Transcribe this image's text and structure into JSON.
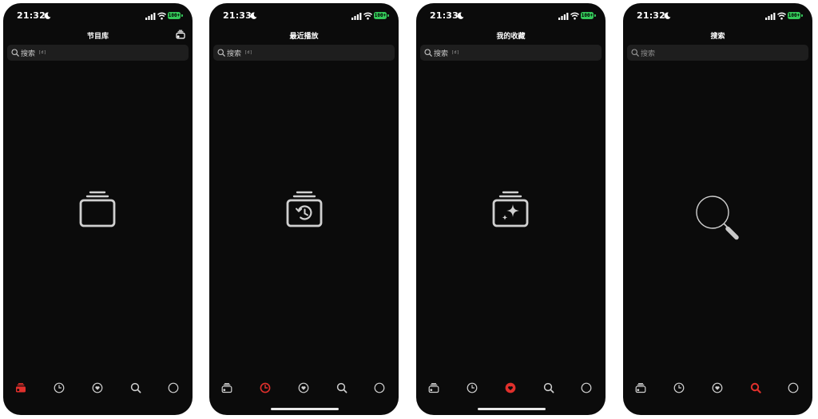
{
  "screens": [
    {
      "time": "21:32",
      "battery": "100+",
      "title": "节目库",
      "search_placeholder": "搜索",
      "search_shortcut": "[d]",
      "empty_icon": "library-stack-icon",
      "active_tab": "library",
      "has_home_indicator": false,
      "has_header_action": true
    },
    {
      "time": "21:33",
      "battery": "100+",
      "title": "最近播放",
      "search_placeholder": "搜索",
      "search_shortcut": "[d]",
      "empty_icon": "history-stack-icon",
      "active_tab": "recent",
      "has_home_indicator": true,
      "has_header_action": false
    },
    {
      "time": "21:33",
      "battery": "100+",
      "title": "我的收藏",
      "search_placeholder": "搜索",
      "search_shortcut": "[d]",
      "empty_icon": "favorites-sparkle-stack-icon",
      "active_tab": "favorites",
      "has_home_indicator": true,
      "has_header_action": false
    },
    {
      "time": "21:32",
      "battery": "100+",
      "title": "搜索",
      "search_placeholder": "搜索",
      "search_shortcut": "",
      "empty_icon": "large-magnifier-icon",
      "active_tab": "search",
      "has_home_indicator": false,
      "has_header_action": false
    }
  ],
  "tabs": [
    {
      "id": "library",
      "icon": "library-icon"
    },
    {
      "id": "recent",
      "icon": "clock-icon"
    },
    {
      "id": "favorites",
      "icon": "heart-icon"
    },
    {
      "id": "search",
      "icon": "search-icon"
    },
    {
      "id": "profile",
      "icon": "profile-icon"
    }
  ],
  "colors": {
    "background": "#0b0b0b",
    "accent": "#e0302c",
    "battery": "#34c759",
    "search_field": "#1e1e1e",
    "inactive_icon": "#d0d0d0"
  }
}
